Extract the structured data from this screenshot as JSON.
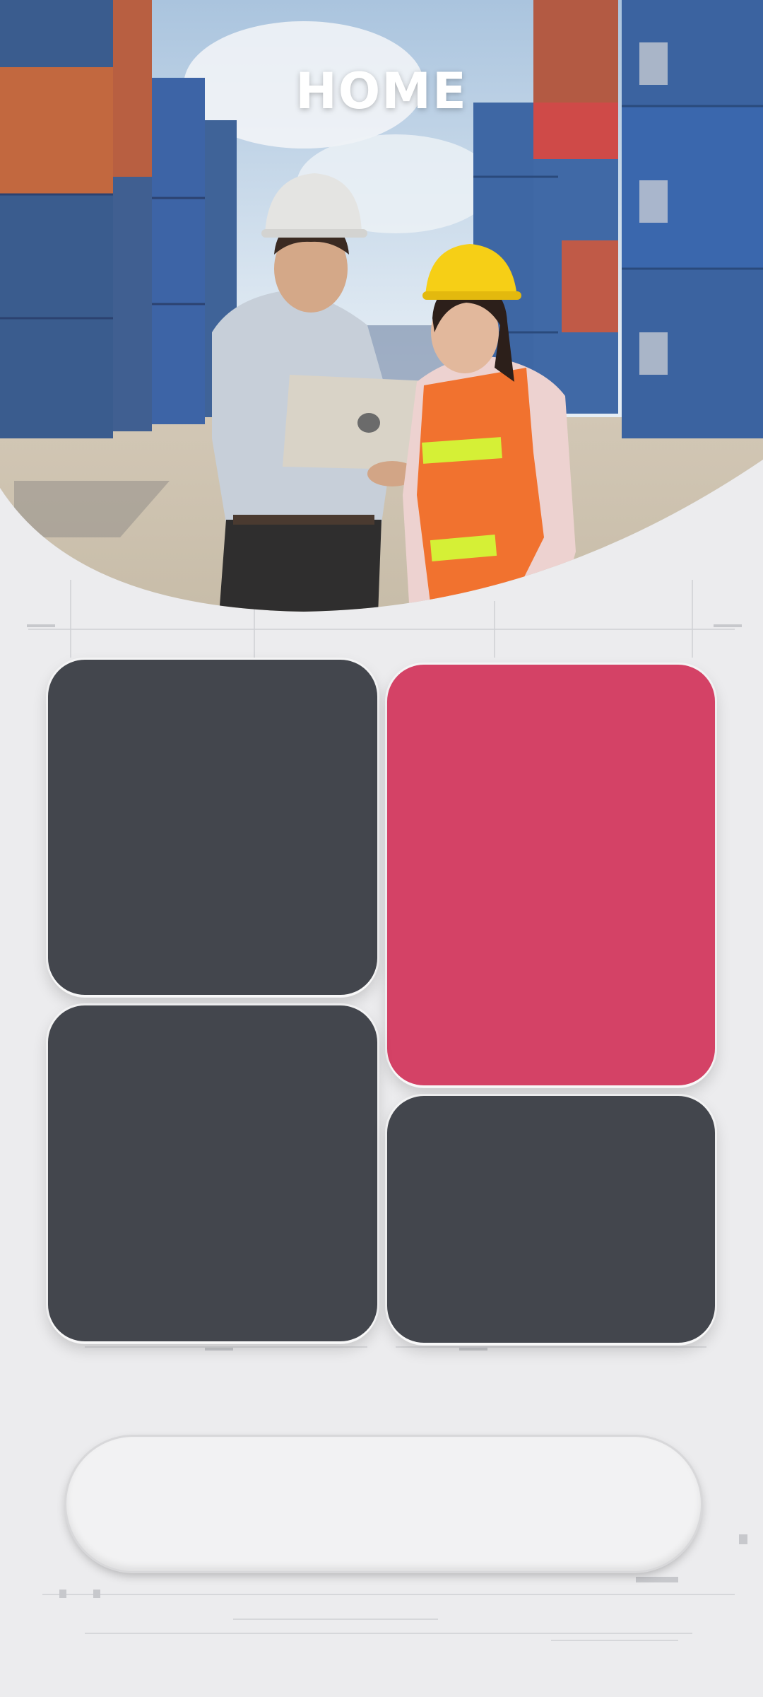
{
  "header": {
    "title": "HOME"
  },
  "hero": {
    "image_icon": "photo-workers-at-container-port"
  },
  "tiles": [
    {
      "id": "tile-1",
      "color": "#43464d"
    },
    {
      "id": "tile-2",
      "color": "#d44266"
    },
    {
      "id": "tile-3",
      "color": "#43464d"
    },
    {
      "id": "tile-4",
      "color": "#43464d"
    }
  ],
  "bottom_bar": {
    "color": "#f2f2f3"
  },
  "colors": {
    "background": "#ececee",
    "accent": "#d44266",
    "dark_tile": "#43464d"
  }
}
